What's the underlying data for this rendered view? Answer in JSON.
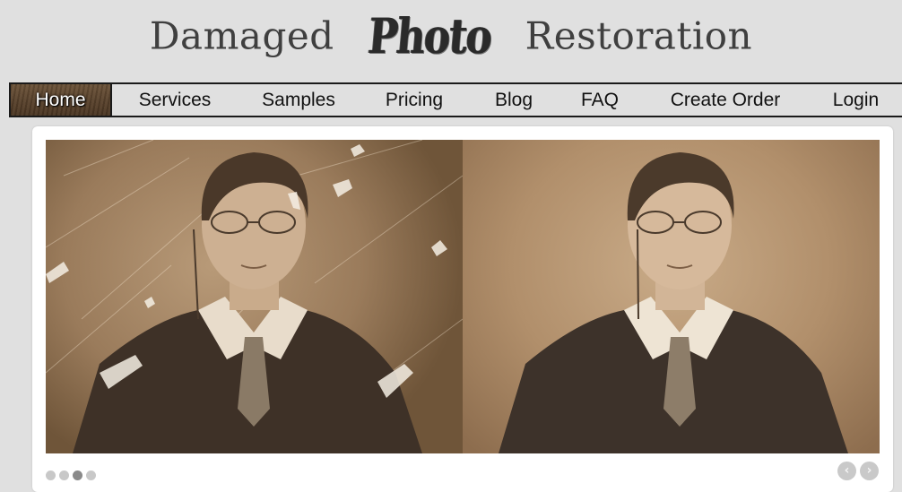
{
  "logo": {
    "word1": "Damaged",
    "word2": "Photo",
    "word3": "Restoration"
  },
  "nav": {
    "items": [
      {
        "label": "Home",
        "active": true
      },
      {
        "label": "Services"
      },
      {
        "label": "Samples"
      },
      {
        "label": "Pricing"
      },
      {
        "label": "Blog"
      },
      {
        "label": "FAQ"
      },
      {
        "label": "Create Order"
      },
      {
        "label": "Login"
      }
    ]
  },
  "slider": {
    "slides": 4,
    "active_slide": 3,
    "prev_icon": "chevron-left-icon",
    "next_icon": "chevron-right-icon",
    "prev_glyph": "‹",
    "next_glyph": "›",
    "images": [
      {
        "name": "damaged-portrait-before"
      },
      {
        "name": "restored-portrait-after"
      }
    ]
  },
  "colors": {
    "background": "#e0e0e0",
    "nav_active": "#5a4330",
    "card": "#ffffff"
  }
}
